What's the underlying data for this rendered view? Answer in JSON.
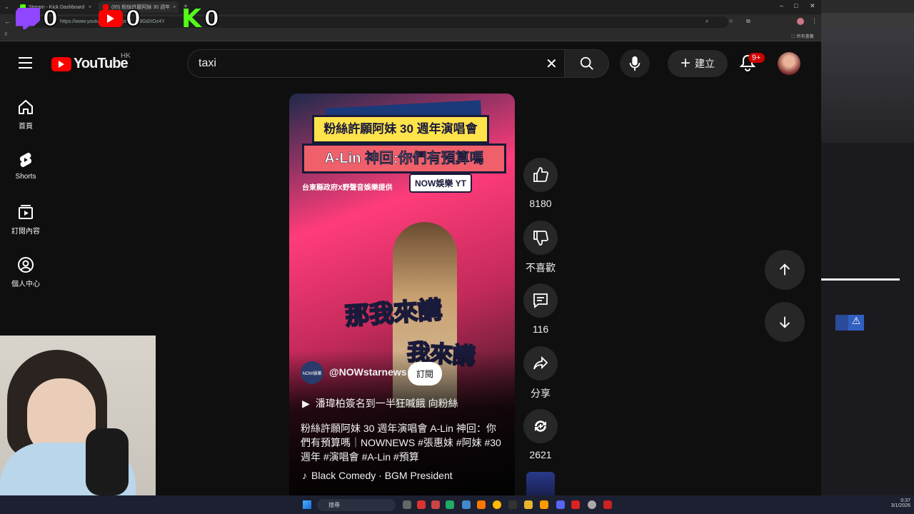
{
  "browser": {
    "tabs": [
      {
        "label": "Stream - Kick Dashboard",
        "color": "#53fc18"
      },
      {
        "label": "(65) 粉絲許願阿妹 30 週年",
        "color": "#ff0000"
      }
    ],
    "url": "https://www.youtube.com/shorts/...B9GdXOz4Y",
    "bookmark_right": "所有書籤"
  },
  "overlay": {
    "twitch_count": "0",
    "youtube_count": "0",
    "kick_count": "0",
    "kick_letter": "K"
  },
  "header": {
    "logo_text": "YouTube",
    "region": "HK",
    "search_value": "taxi",
    "create_label": "建立",
    "notif_badge": "9+"
  },
  "sidebar": {
    "items": [
      {
        "label": "首頁",
        "icon": "home-icon"
      },
      {
        "label": "Shorts",
        "icon": "shorts-icon"
      },
      {
        "label": "訂閱內容",
        "icon": "subscriptions-icon"
      },
      {
        "label": "個人中心",
        "icon": "account-icon"
      }
    ]
  },
  "video": {
    "title_banner_1": "粉絲許願阿妹 30 週年演唱會",
    "title_banner_2": "A-Lin 神回:你們有預算嗎",
    "credit": "台東縣政府X野聲音娛樂提供",
    "brand_tag": "NOW娛樂 YT",
    "caption_1": "那我來講",
    "caption_2": "我來講",
    "channel": "@NOWstarnews",
    "channel_avatar_text": "NOW娛樂",
    "subscribe_label": "訂閱",
    "playlist_label": "潘瑋柏簽名到一半狂喊餓 向粉絲",
    "description": "粉絲許願阿妹 30 週年演唱會 A-Lin 神回：你們有預算嗎｜NOWNEWS #張惠妹 #阿妹 #30週年 #演唱會 #A-Lin #預算",
    "music": "Black Comedy · BGM President"
  },
  "actions": {
    "likes": "8180",
    "dislike_label": "不喜歡",
    "comments": "116",
    "share_label": "分享",
    "remix": "2621"
  },
  "taskbar": {
    "search_placeholder": "搜尋",
    "time": "0:37",
    "date": "3/1/2026"
  }
}
